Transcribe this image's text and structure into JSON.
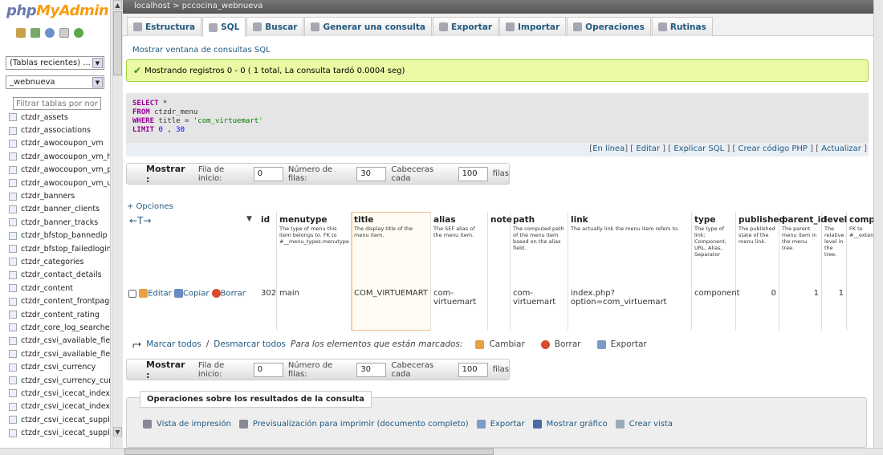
{
  "logo": {
    "a": "php",
    "b": "MyAdmin"
  },
  "sidebar": {
    "recent": "(Tablas recientes) ...",
    "db": "_webnueva",
    "filter_placeholder": "Filtrar tablas por nombre",
    "tables": [
      "ctzdr_assets",
      "ctzdr_associations",
      "ctzdr_awocoupon_vm",
      "ctzdr_awocoupon_vm_hist",
      "ctzdr_awocoupon_vm_pro",
      "ctzdr_awocoupon_vm_use",
      "ctzdr_banners",
      "ctzdr_banner_clients",
      "ctzdr_banner_tracks",
      "ctzdr_bfstop_bannedip",
      "ctzdr_bfstop_failedlogin",
      "ctzdr_categories",
      "ctzdr_contact_details",
      "ctzdr_content",
      "ctzdr_content_frontpage",
      "ctzdr_content_rating",
      "ctzdr_core_log_searches",
      "ctzdr_csvi_available_fields",
      "ctzdr_csvi_available_fields",
      "ctzdr_csvi_currency",
      "ctzdr_csvi_currency_curre",
      "ctzdr_csvi_icecat_index",
      "ctzdr_csvi_icecat_index_c",
      "ctzdr_csvi_icecat_supplie",
      "ctzdr_csvi_icecat_supplie"
    ]
  },
  "breadcrumb": {
    "server": "localhost",
    "sep": ">",
    "db": "pccocina_webnueva"
  },
  "tabs": [
    "Estructura",
    "SQL",
    "Buscar",
    "Generar una consulta",
    "Exportar",
    "Importar",
    "Operaciones",
    "Rutinas"
  ],
  "sqlwindow": "Mostrar ventana de consultas SQL",
  "success": "Mostrando registros 0 - 0 ( 1 total, La consulta tardó 0.0004 seg)",
  "sql": {
    "l1a": "SELECT",
    "l1b": " *",
    "l2a": "FROM",
    "l2b": " ctzdr_menu",
    "l3a": "WHERE",
    "l3b": " title",
    "l3c": " = ",
    "l3d": "'com_virtuemart'",
    "l4a": "LIMIT",
    "l4b": " 0 , 30"
  },
  "links": {
    "a": "En línea",
    "b": "Editar",
    "c": "Explicar SQL",
    "d": "Crear código PHP",
    "e": "Actualizar"
  },
  "nav": {
    "show": "Mostrar :",
    "start_label": "Fila de inicio:",
    "start": "0",
    "rows_label": "Número de filas:",
    "rows": "30",
    "head_label": "Cabeceras cada",
    "head": "100",
    "rows_word": "filas"
  },
  "options": "+ Opciones",
  "columns": [
    {
      "name": "id",
      "desc": ""
    },
    {
      "name": "menutype",
      "desc": "The type of menu this item belongs to. FK to #__menu_types.menutype"
    },
    {
      "name": "title",
      "desc": "The display title of the menu item."
    },
    {
      "name": "alias",
      "desc": "The SEF alias of the menu item."
    },
    {
      "name": "note",
      "desc": ""
    },
    {
      "name": "path",
      "desc": "The computed path of the menu item based on the alias field."
    },
    {
      "name": "link",
      "desc": "The actually link the menu item refers to."
    },
    {
      "name": "type",
      "desc": "The type of link: Component, URL, Alias, Separator"
    },
    {
      "name": "published",
      "desc": "The published state of the menu link."
    },
    {
      "name": "parent_id",
      "desc": "The parent menu item in the menu tree."
    },
    {
      "name": "level",
      "desc": "The relative level in the tree."
    },
    {
      "name": "compo",
      "desc": "FK to #__exten"
    }
  ],
  "row": {
    "edit": "Editar",
    "copy": "Copiar",
    "delete": "Borrar",
    "id": "302",
    "menutype": "main",
    "title": "COM_VIRTUEMART",
    "alias": "com-virtuemart",
    "note": "",
    "path": "com-virtuemart",
    "link": "index.php?option=com_virtuemart",
    "type": "component",
    "published": "0",
    "parent_id": "1",
    "level": "1"
  },
  "marks": {
    "check": "Marcar todos",
    "sep": " / ",
    "uncheck": "Desmarcar todos",
    "italic": "Para los elementos que están marcados:",
    "change": "Cambiar",
    "delete": "Borrar",
    "export": "Exportar"
  },
  "resops": {
    "legend": "Operaciones sobre los resultados de la consulta",
    "print": "Vista de impresión",
    "printall": "Previsualización para imprimir (documento completo)",
    "export": "Exportar",
    "chart": "Mostrar gráfico",
    "view": "Crear vista"
  }
}
